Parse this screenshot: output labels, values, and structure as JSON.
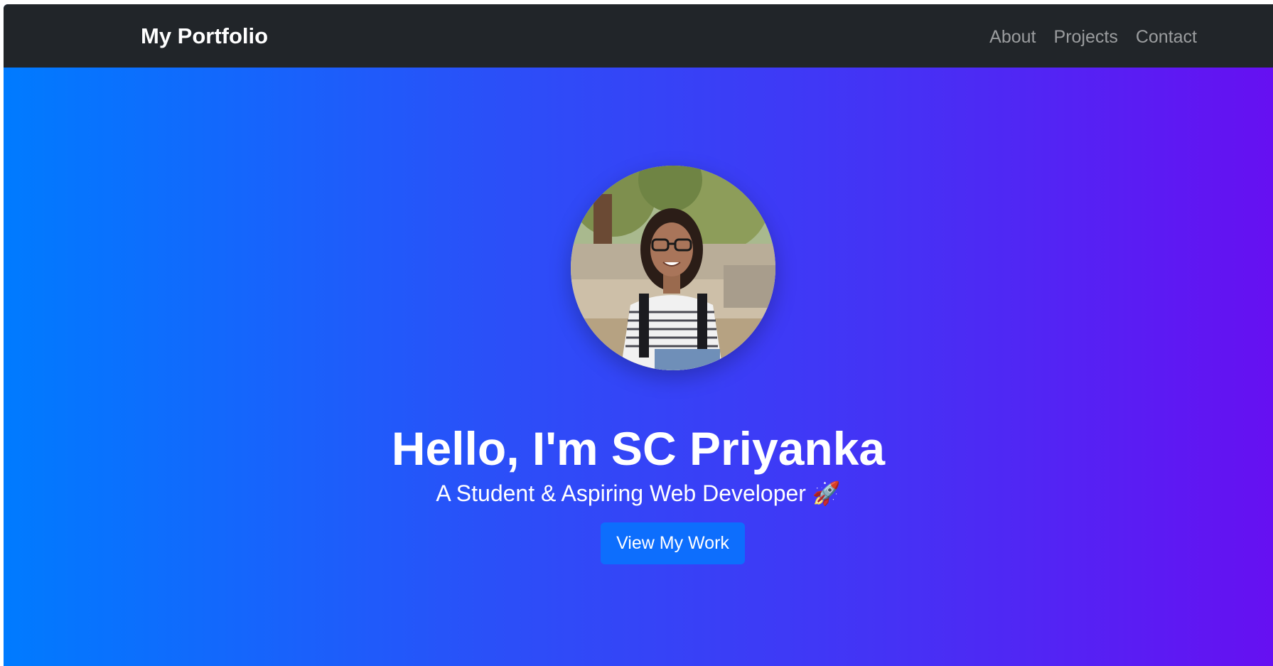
{
  "navbar": {
    "brand": "My Portfolio",
    "links": [
      {
        "label": "About"
      },
      {
        "label": "Projects"
      },
      {
        "label": "Contact"
      }
    ]
  },
  "hero": {
    "headline": "Hello, I'm SC Priyanka",
    "subline": "A Student & Aspiring Web Developer 🚀",
    "cta_label": "View My Work",
    "avatar_icon": "profile-photo"
  },
  "colors": {
    "navbar_bg": "#212529",
    "hero_gradient_start": "#007bff",
    "hero_gradient_end": "#6610f2",
    "cta_bg": "#0d6efd",
    "text": "#ffffff"
  }
}
